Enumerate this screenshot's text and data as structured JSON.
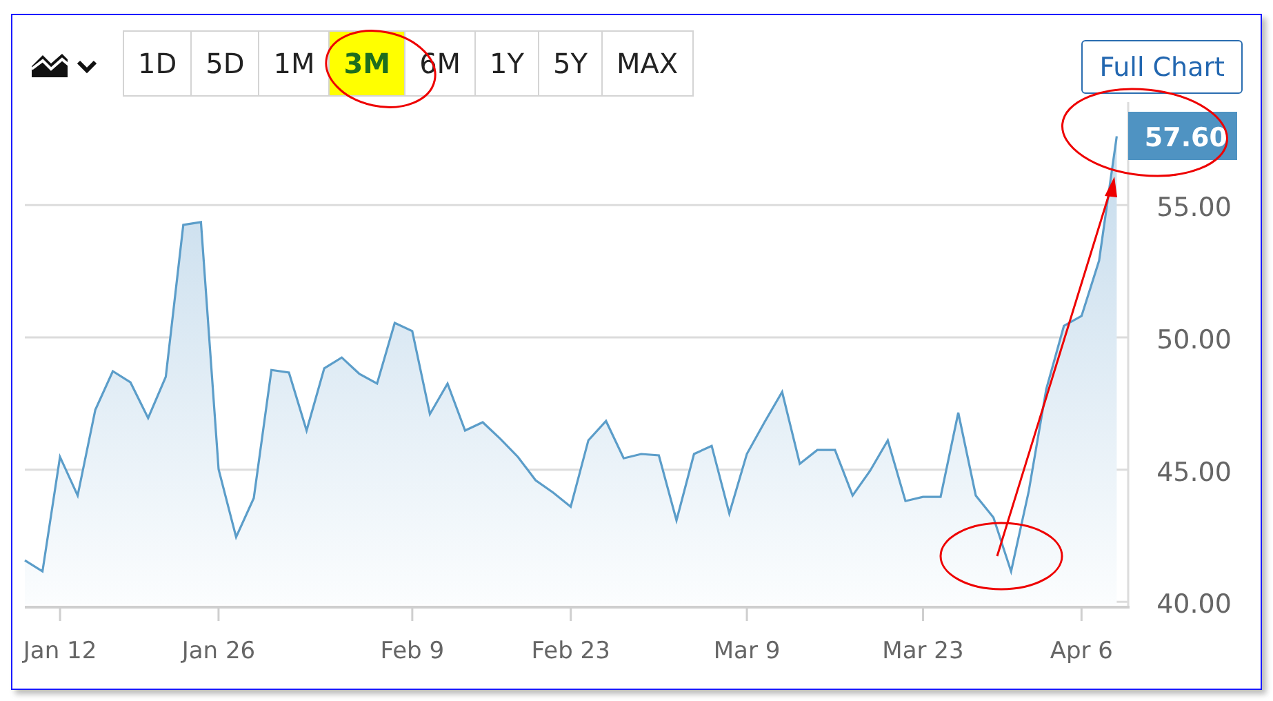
{
  "toolbar": {
    "range_buttons": [
      {
        "label": "1D",
        "selected": false
      },
      {
        "label": "5D",
        "selected": false
      },
      {
        "label": "1M",
        "selected": false
      },
      {
        "label": "3M",
        "selected": true
      },
      {
        "label": "6M",
        "selected": false
      },
      {
        "label": "1Y",
        "selected": false
      },
      {
        "label": "5Y",
        "selected": false
      },
      {
        "label": "MAX",
        "selected": false
      }
    ],
    "full_chart_button": "Full Chart"
  },
  "chart": {
    "price_label": "57.60",
    "chart_data": {
      "type": "area",
      "categories": [
        null,
        null,
        "Jan 12",
        null,
        null,
        null,
        null,
        null,
        null,
        null,
        null,
        "Jan 26",
        null,
        null,
        null,
        null,
        null,
        null,
        null,
        null,
        null,
        null,
        "Feb 9",
        null,
        null,
        null,
        null,
        null,
        null,
        null,
        null,
        "Feb 23",
        null,
        null,
        null,
        null,
        null,
        null,
        null,
        null,
        null,
        "Mar 9",
        null,
        null,
        null,
        null,
        null,
        null,
        null,
        null,
        null,
        "Mar 23",
        null,
        null,
        null,
        null,
        null,
        null,
        null,
        null,
        "Apr 6",
        null,
        null
      ],
      "series": [
        {
          "color": "#5b9dc9",
          "values": [
            41.57,
            41.15,
            45.48,
            44.02,
            47.26,
            48.72,
            48.3,
            46.95,
            48.51,
            54.26,
            54.36,
            45.01,
            42.45,
            43.92,
            48.77,
            48.67,
            46.48,
            48.83,
            49.24,
            48.62,
            48.25,
            50.55,
            50.24,
            47.1,
            48.25,
            46.48,
            46.79,
            46.16,
            45.48,
            44.6,
            44.13,
            43.6,
            46.11,
            46.84,
            45.43,
            45.59,
            45.54,
            43.08,
            45.59,
            45.9,
            43.34,
            45.59,
            46.79,
            47.94,
            45.22,
            45.74,
            45.74,
            44.02,
            44.96,
            46.11,
            43.81,
            43.97,
            43.97,
            47.15,
            44.02,
            43.19,
            41.15,
            44.18,
            48.04,
            50.44,
            50.81,
            52.9,
            57.6
          ]
        }
      ],
      "ylim": [
        39.8,
        59
      ],
      "grid": true,
      "yticks": [
        {
          "value": 40,
          "label": "40.00"
        },
        {
          "value": 45,
          "label": "45.00"
        },
        {
          "value": 50,
          "label": "50.00"
        },
        {
          "value": 55,
          "label": "55.00"
        }
      ]
    }
  }
}
